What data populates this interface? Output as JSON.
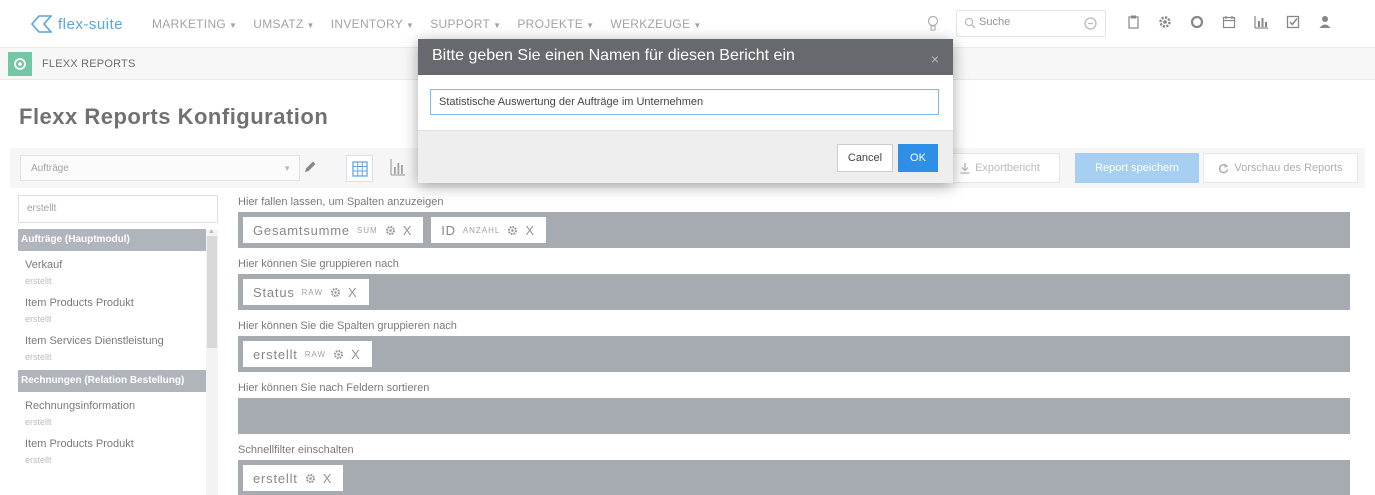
{
  "app": {
    "logo": "flex-suite"
  },
  "nav": {
    "menu": [
      {
        "label": "MARKETING"
      },
      {
        "label": "UMSATZ"
      },
      {
        "label": "INVENTORY"
      },
      {
        "label": "SUPPORT"
      },
      {
        "label": "PROJEKTE"
      },
      {
        "label": "WERKZEUGE"
      }
    ],
    "search_placeholder": "Suche",
    "icons": [
      "lightbulb-icon",
      "search-icon",
      "clear-icon",
      "clipboard-icon",
      "gear-icon",
      "circle-icon",
      "calendar-icon",
      "bar-chart-icon",
      "checkbox-icon",
      "user-icon"
    ]
  },
  "subheader": {
    "title": "FLEXX REPORTS"
  },
  "page": {
    "title": "Flexx Reports Konfiguration"
  },
  "toolbar": {
    "module_select": "Aufträge",
    "export_label": "Exportbericht",
    "save_label": "Report speichern",
    "preview_label": "Vorschau des Reports"
  },
  "sidebar": {
    "search_value": "erstellt",
    "groups": [
      {
        "title": "Aufträge (Hauptmodul)",
        "items": [
          {
            "name": "Verkauf",
            "sub": "erstellt"
          },
          {
            "name": "Item Products Produkt",
            "sub": "erstellt"
          },
          {
            "name": "Item Services Dienstleistung",
            "sub": "erstellt"
          }
        ]
      },
      {
        "title": "Rechnungen (Relation Bestellung)",
        "items": [
          {
            "name": "Rechnungsinformation",
            "sub": "erstellt"
          },
          {
            "name": "Item Products Produkt",
            "sub": "erstellt"
          }
        ]
      }
    ]
  },
  "zones": {
    "columns": {
      "label": "Hier fallen lassen, um Spalten anzuzeigen",
      "chips": [
        {
          "name": "Gesamtsumme",
          "tag": "SUM"
        },
        {
          "name": "ID",
          "tag": "ANZAHL"
        }
      ]
    },
    "group_rows": {
      "label": "Hier können Sie gruppieren nach",
      "chips": [
        {
          "name": "Status",
          "tag": "RAW"
        }
      ]
    },
    "group_cols": {
      "label": "Hier können Sie die Spalten gruppieren nach",
      "chips": [
        {
          "name": "erstellt",
          "tag": "RAW"
        }
      ]
    },
    "sort": {
      "label": "Hier können Sie nach Feldern sortieren",
      "chips": []
    },
    "filter": {
      "label": "Schnellfilter einschalten",
      "chips": [
        {
          "name": "erstellt",
          "tag": ""
        }
      ]
    },
    "remove_glyph": "X"
  },
  "modal": {
    "title": "Bitte geben Sie einen Namen für diesen Bericht ein",
    "close": "×",
    "input_value": "Statistische Auswertung der Aufträge im Unternehmen",
    "cancel_label": "Cancel",
    "ok_label": "OK"
  },
  "colors": {
    "brand": "#2a8bd3",
    "module_green": "#4db88b",
    "zone_gray": "#8c949c",
    "primary_button": "#2f8ee6",
    "save_button": "#8ec2ee",
    "modal_header": "#666a6e"
  }
}
